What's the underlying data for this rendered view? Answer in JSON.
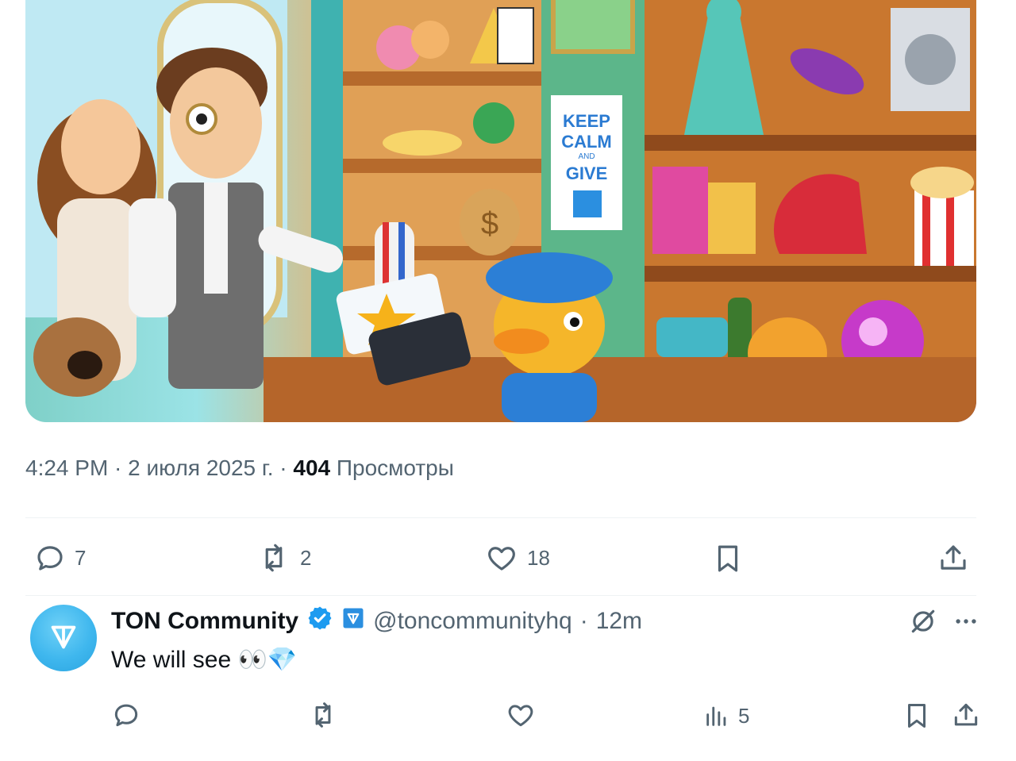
{
  "tweet": {
    "time": "4:24 PM",
    "sep1": " · ",
    "date": "2 июля 2025 г.",
    "sep2": " · ",
    "views_count": "404",
    "views_label": "Просмотры",
    "actions": {
      "replies": "7",
      "reposts": "2",
      "likes": "18"
    },
    "image_lettering": {
      "line1": "KEEP",
      "line2": "CALM",
      "line3": "AND",
      "line4": "GIVE"
    }
  },
  "reply": {
    "name": "TON Community",
    "handle": "@toncommunityhq",
    "sep": " · ",
    "time": "12m",
    "text": "We will see 👀💎",
    "actions": {
      "views": "5"
    }
  },
  "colors": {
    "text_primary": "#0f1419",
    "text_secondary": "#536471",
    "verified_blue": "#1d9bf0",
    "avatar_blue": "#3fb7ee"
  }
}
